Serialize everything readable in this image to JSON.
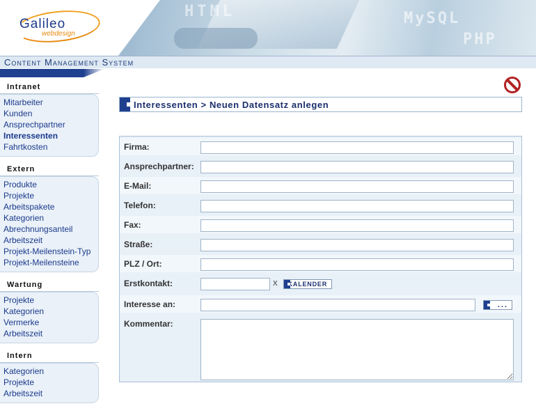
{
  "header": {
    "logo_name": "Galileo",
    "logo_sub": "webdesign",
    "photo_words": [
      "HTML",
      "MySQL",
      "PHP"
    ],
    "cms_title": "Content Management System"
  },
  "sidebar": {
    "sections": [
      {
        "title": "Intranet",
        "items": [
          "Mitarbeiter",
          "Kunden",
          "Ansprechpartner",
          "Interessenten",
          "Fahrtkosten"
        ],
        "active": "Interessenten"
      },
      {
        "title": "Extern",
        "items": [
          "Produkte",
          "Projekte",
          "Arbeitspakete",
          "Kategorien",
          "Abrechnungsanteil",
          "Arbeitszeit",
          "Projekt-Meilenstein-Typ",
          "Projekt-Meilensteine"
        ]
      },
      {
        "title": "Wartung",
        "items": [
          "Projekte",
          "Kategorien",
          "Vermerke",
          "Arbeitszeit"
        ]
      },
      {
        "title": "Intern",
        "items": [
          "Kategorien",
          "Projekte",
          "Arbeitszeit"
        ]
      }
    ]
  },
  "main": {
    "title": "Interessenten > Neuen Datensatz anlegen",
    "form": {
      "firma_label": "Firma:",
      "ansprechpartner_label": "Ansprechpartner:",
      "email_label": "E-Mail:",
      "telefon_label": "Telefon:",
      "fax_label": "Fax:",
      "strasse_label": "Straße:",
      "plz_ort_label": "PLZ / Ort:",
      "erstkontakt_label": "Erstkontakt:",
      "erstkontakt_clear": "X",
      "kalender_button": "KALENDER",
      "interesse_label": "Interesse an:",
      "more_button": "...",
      "kommentar_label": "Kommentar:"
    }
  },
  "colors": {
    "accent": "#1f3f8f",
    "link": "#1b3a8c",
    "stop": "#b22222"
  }
}
